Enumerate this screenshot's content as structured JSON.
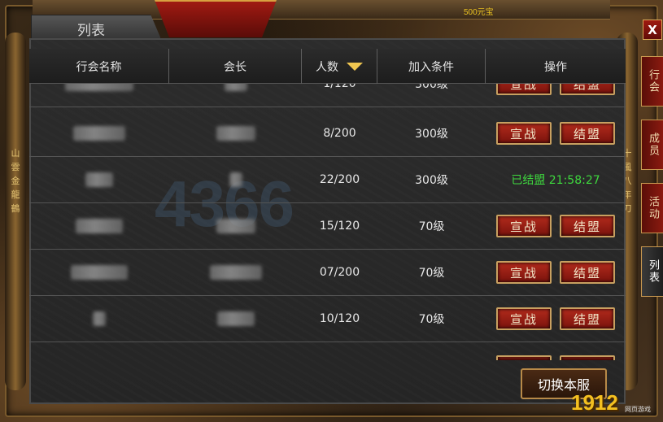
{
  "top": {
    "gold_text": "500元宝"
  },
  "title": "列表",
  "header": {
    "col_name": "行会名称",
    "col_leader": "会长",
    "col_members": "人数",
    "col_condition": "加入条件",
    "col_action": "操作"
  },
  "rows": [
    {
      "members": "1/120",
      "condition": "300级",
      "action": "buttons"
    },
    {
      "members": "8/200",
      "condition": "300级",
      "action": "buttons"
    },
    {
      "members": "22/200",
      "condition": "300级",
      "action": "status",
      "status_text": "已结盟 21:58:27"
    },
    {
      "members": "15/120",
      "condition": "70级",
      "action": "buttons"
    },
    {
      "members": "07/200",
      "condition": "70级",
      "action": "buttons"
    },
    {
      "members": "10/120",
      "condition": "70级",
      "action": "buttons"
    },
    {
      "members": "",
      "condition": "",
      "action": "buttons"
    }
  ],
  "buttons": {
    "declare_war": "宣战",
    "alliance": "结盟"
  },
  "footer": {
    "switch_server": "切换本服"
  },
  "side_tabs": [
    {
      "label": "行会"
    },
    {
      "label": "成员"
    },
    {
      "label": "活动"
    },
    {
      "label": "列表"
    }
  ],
  "close_label": "X",
  "colors": {
    "allied_green": "#3ed83e",
    "button_red": "#b22a1c",
    "sort_arrow": "#f0c650"
  },
  "logo": {
    "brand": "1912",
    "sub": "网页游戏"
  }
}
